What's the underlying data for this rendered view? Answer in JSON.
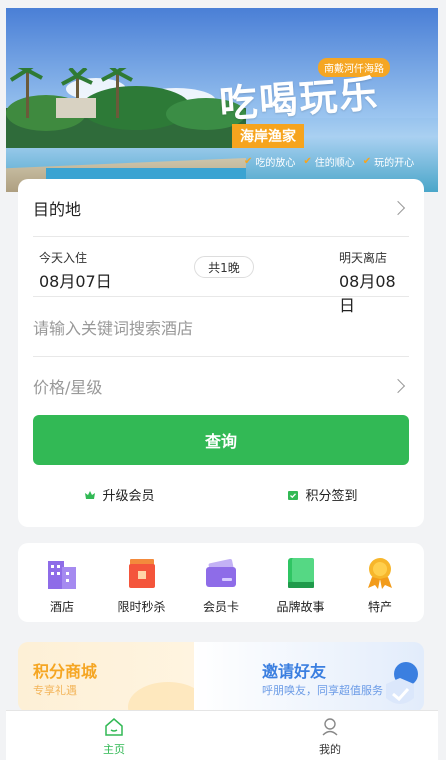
{
  "banner": {
    "title": "吃喝玩乐",
    "tag_top": "南戴河仟海路",
    "tag_name": "海岸渔家",
    "features": [
      "吃的放心",
      "住的顺心",
      "玩的开心"
    ]
  },
  "search": {
    "destination_label": "目的地",
    "checkin_label": "今天入住",
    "checkin_date": "08月07日",
    "nights": "共1晚",
    "checkout_label": "明天离店",
    "checkout_date": "08月08日",
    "keyword_placeholder": "请输入关键词搜索酒店",
    "price_label": "价格/星级",
    "search_button": "查询",
    "upgrade_label": "升级会员",
    "checkin_points_label": "积分签到"
  },
  "grid": [
    {
      "label": "酒店",
      "icon": "hotel-icon"
    },
    {
      "label": "限时秒杀",
      "icon": "flash-sale-icon"
    },
    {
      "label": "会员卡",
      "icon": "member-card-icon"
    },
    {
      "label": "品牌故事",
      "icon": "brand-story-icon"
    },
    {
      "label": "特产",
      "icon": "specialty-icon"
    }
  ],
  "promo": {
    "left_title": "积分商城",
    "left_sub": "专享礼遇",
    "right_title": "邀请好友",
    "right_sub": "呼朋唤友，同享超值服务"
  },
  "nav": {
    "home": "主页",
    "mine": "我的"
  },
  "colors": {
    "accent": "#32b955",
    "promo_orange": "#f5a623",
    "promo_blue": "#3b7fe0"
  }
}
